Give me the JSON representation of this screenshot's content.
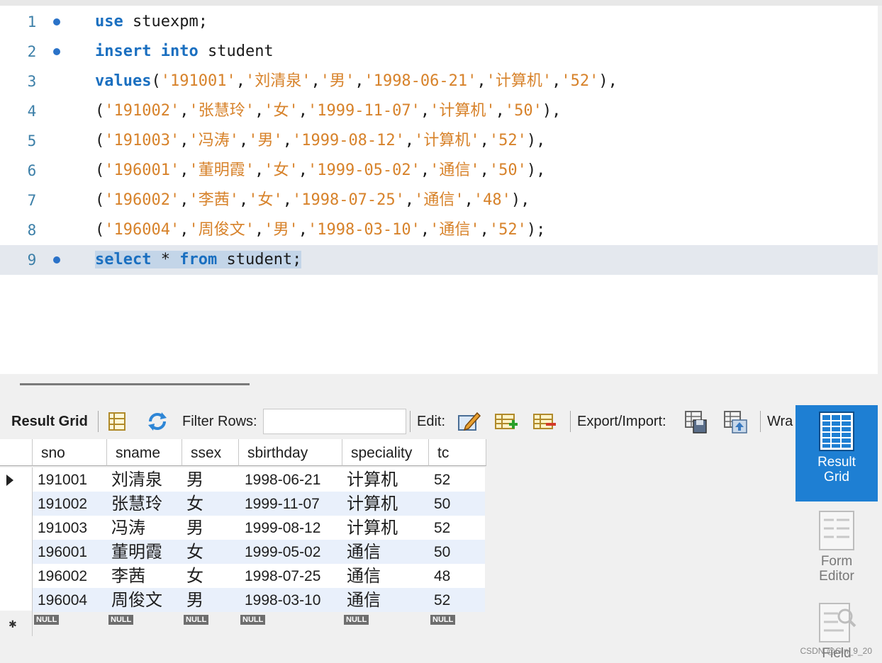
{
  "editor": {
    "lines": [
      {
        "num": "1",
        "breakpoint": true
      },
      {
        "num": "2",
        "breakpoint": true
      },
      {
        "num": "3",
        "breakpoint": false
      },
      {
        "num": "4",
        "breakpoint": false
      },
      {
        "num": "5",
        "breakpoint": false
      },
      {
        "num": "6",
        "breakpoint": false
      },
      {
        "num": "7",
        "breakpoint": false
      },
      {
        "num": "8",
        "breakpoint": false
      },
      {
        "num": "9",
        "breakpoint": true
      }
    ],
    "code": {
      "l1_kw": "use",
      "l1_rest": " stuexpm;",
      "l2_kw1": "insert",
      "l2_kw2": "into",
      "l2_rest": " student",
      "l3_kw": "values",
      "l3_open": "(",
      "l3_v": [
        "'191001'",
        "'刘清泉'",
        "'男'",
        "'1998-06-21'",
        "'计算机'",
        "'52'"
      ],
      "l3_close": "),",
      "l4_v": [
        "'191002'",
        "'张慧玲'",
        "'女'",
        "'1999-11-07'",
        "'计算机'",
        "'50'"
      ],
      "l4_close": "),",
      "l5_v": [
        "'191003'",
        "'冯涛'",
        "'男'",
        "'1999-08-12'",
        "'计算机'",
        "'52'"
      ],
      "l5_close": "),",
      "l6_v": [
        "'196001'",
        "'董明霞'",
        "'女'",
        "'1999-05-02'",
        "'通信'",
        "'50'"
      ],
      "l6_close": "),",
      "l7_v": [
        "'196002'",
        "'李茜'",
        "'女'",
        "'1998-07-25'",
        "'通信'",
        "'48'"
      ],
      "l7_close": "),",
      "l8_v": [
        "'196004'",
        "'周俊文'",
        "'男'",
        "'1998-03-10'",
        "'通信'",
        "'52'"
      ],
      "l8_close": ");",
      "l9_kw1": "select",
      "l9_mid": " * ",
      "l9_kw2": "from",
      "l9_rest": " student;"
    }
  },
  "toolbar": {
    "result_grid": "Result Grid",
    "filter_rows": "Filter Rows:",
    "filter_value": "",
    "edit": "Edit:",
    "export_import": "Export/Import:",
    "wrap": "Wra"
  },
  "grid": {
    "columns": [
      "sno",
      "sname",
      "ssex",
      "sbirthday",
      "speciality",
      "tc"
    ],
    "rows": [
      [
        "191001",
        "刘清泉",
        "男",
        "1998-06-21",
        "计算机",
        "52"
      ],
      [
        "191002",
        "张慧玲",
        "女",
        "1999-11-07",
        "计算机",
        "50"
      ],
      [
        "191003",
        "冯涛",
        "男",
        "1999-08-12",
        "计算机",
        "52"
      ],
      [
        "196001",
        "董明霞",
        "女",
        "1999-05-02",
        "通信",
        "50"
      ],
      [
        "196002",
        "李茜",
        "女",
        "1998-07-25",
        "通信",
        "48"
      ],
      [
        "196004",
        "周俊文",
        "男",
        "1998-03-10",
        "通信",
        "52"
      ]
    ],
    "null_label": "NULL"
  },
  "side_panel": {
    "result_grid_line1": "Result",
    "result_grid_line2": "Grid",
    "form_editor_line1": "Form",
    "form_editor_line2": "Editor",
    "field_label": "Field"
  },
  "watermark": "CSDN @Gin_9_20",
  "colors": {
    "keyword": "#1a6fc0",
    "string": "#d7822a",
    "active_tab": "#1e7fd3"
  }
}
